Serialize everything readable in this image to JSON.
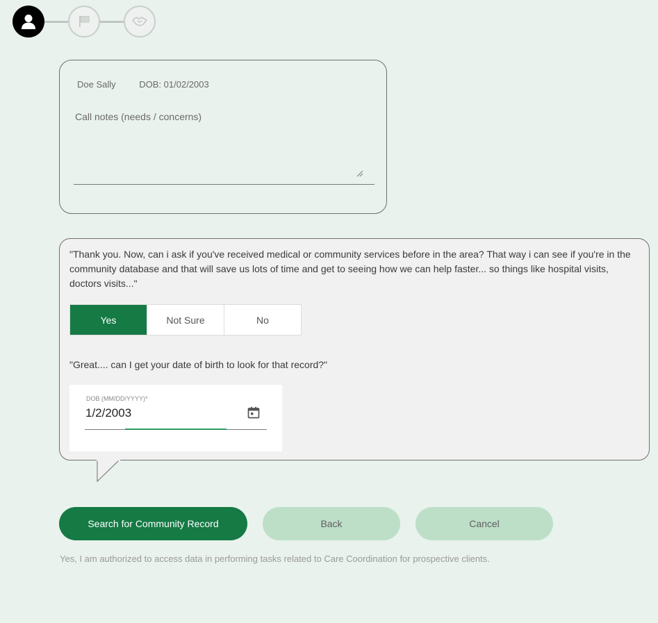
{
  "stepper": {
    "steps": [
      {
        "icon": "person-icon",
        "state": "active"
      },
      {
        "icon": "flag-icon",
        "state": "inactive"
      },
      {
        "icon": "handshake-icon",
        "state": "inactive"
      }
    ]
  },
  "patient": {
    "name": "Doe Sally",
    "dob": "DOB: 01/02/2003"
  },
  "notes": {
    "label": "Call notes  (needs / concerns)",
    "value": ""
  },
  "question": {
    "text": "\"Thank you. Now, can i ask if you've received medical or community services before in the area? That way i can see if you're in the community database and that will save us lots of time and get to seeing how we can help faster... so things like hospital visits, doctors visits...\"",
    "options": [
      "Yes",
      "Not Sure",
      "No"
    ],
    "selected": "Yes"
  },
  "followup": {
    "text": "\"Great.... can I get your date of birth to look for that record?\""
  },
  "dob_field": {
    "label": "DOB (MM/DD/YYYY)*",
    "value": "1/2/2003",
    "icon": "calendar-icon"
  },
  "actions": {
    "search_label": "Search for Community Record",
    "back_label": "Back",
    "cancel_label": "Cancel"
  },
  "authorization": {
    "text": "Yes, I am authorized to access data in performing tasks related to Care Coordination for prospective clients."
  },
  "colors": {
    "primary": "#157a44",
    "secondary": "#bddfc8",
    "background": "#e9f2ec"
  }
}
